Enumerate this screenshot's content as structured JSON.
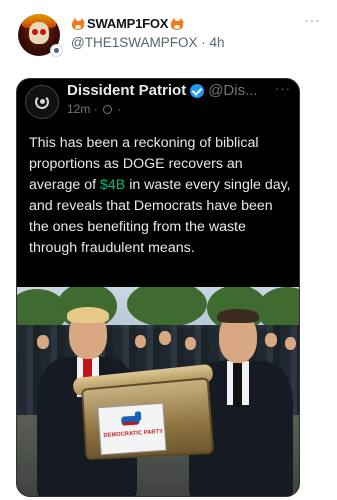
{
  "author": {
    "display_name": "SWAMP1FOX",
    "handle": "@THE1SWAMPFOX",
    "time": "4h",
    "avatar_icon": "flaming-skull-avatar",
    "name_emoji": "fox-face"
  },
  "actions": {
    "more_label": "···"
  },
  "quoted": {
    "display_name": "Dissident Patriot",
    "handle": "@Dis...",
    "time": "12m",
    "separator": "·",
    "more_label": "···",
    "verified": true,
    "text_before": "This has been a reckoning of biblical proportions as DOGE recovers an average of ",
    "text_money": "$4B",
    "text_after": " in waste every single day, and reveals that Democrats have been the ones benefiting from the waste through fraudulent means.",
    "image": {
      "plate_text": "DEMOCRATIC PARTY"
    }
  },
  "colors": {
    "verified_blue": "#1d9bf0",
    "money_green": "#00ba7c",
    "card_bg": "#000000"
  }
}
